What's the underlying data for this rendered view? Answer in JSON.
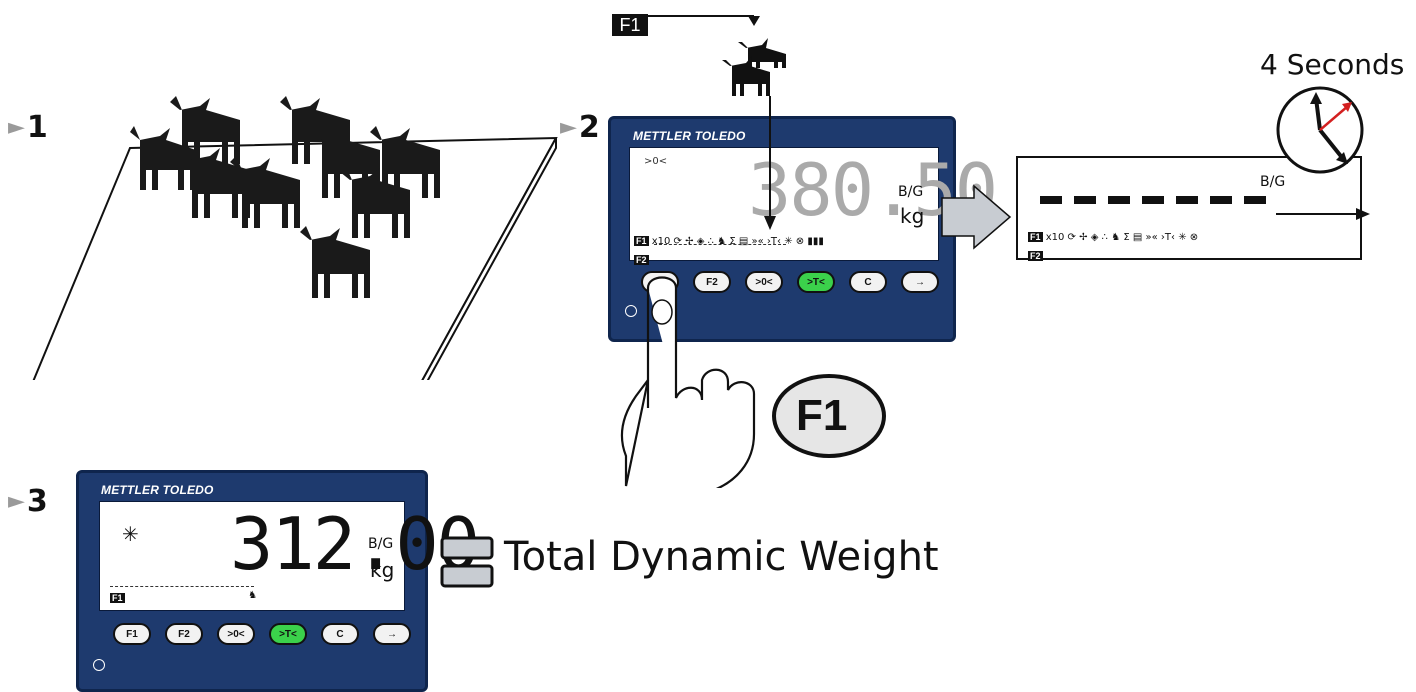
{
  "steps": {
    "s1": "1",
    "s2": "2",
    "s3": "3"
  },
  "top_f1_tag": "F1",
  "terminal2": {
    "brand": "METTLER TOLEDO",
    "zero_indicator": ">0<",
    "weight": "380.50",
    "mode": "B/G",
    "unit": "kg",
    "f1_tag": "F1",
    "f2_tag": "F2",
    "multiplier": "x10",
    "keys": [
      "F1",
      "F2",
      ">0<",
      ">T<",
      "C",
      "→"
    ]
  },
  "display_zoom": {
    "mode": "B/G",
    "f1_tag": "F1",
    "f2_tag": "F2",
    "multiplier": "x10"
  },
  "timer": {
    "label": "4 Seconds"
  },
  "f1_callout": "F1",
  "terminal3": {
    "brand": "METTLER TOLEDO",
    "star": "✳",
    "weight": "312.00",
    "mode": "B/G",
    "unit": "kg",
    "f1_tag": "F1",
    "keys": [
      "F1",
      "F2",
      ">0<",
      ">T<",
      "C",
      "→"
    ]
  },
  "caption": "Total Dynamic Weight",
  "colors": {
    "terminal_blue": "#1e3a6e",
    "accent_green": "#3bd14b",
    "clock_red": "#d32020"
  }
}
